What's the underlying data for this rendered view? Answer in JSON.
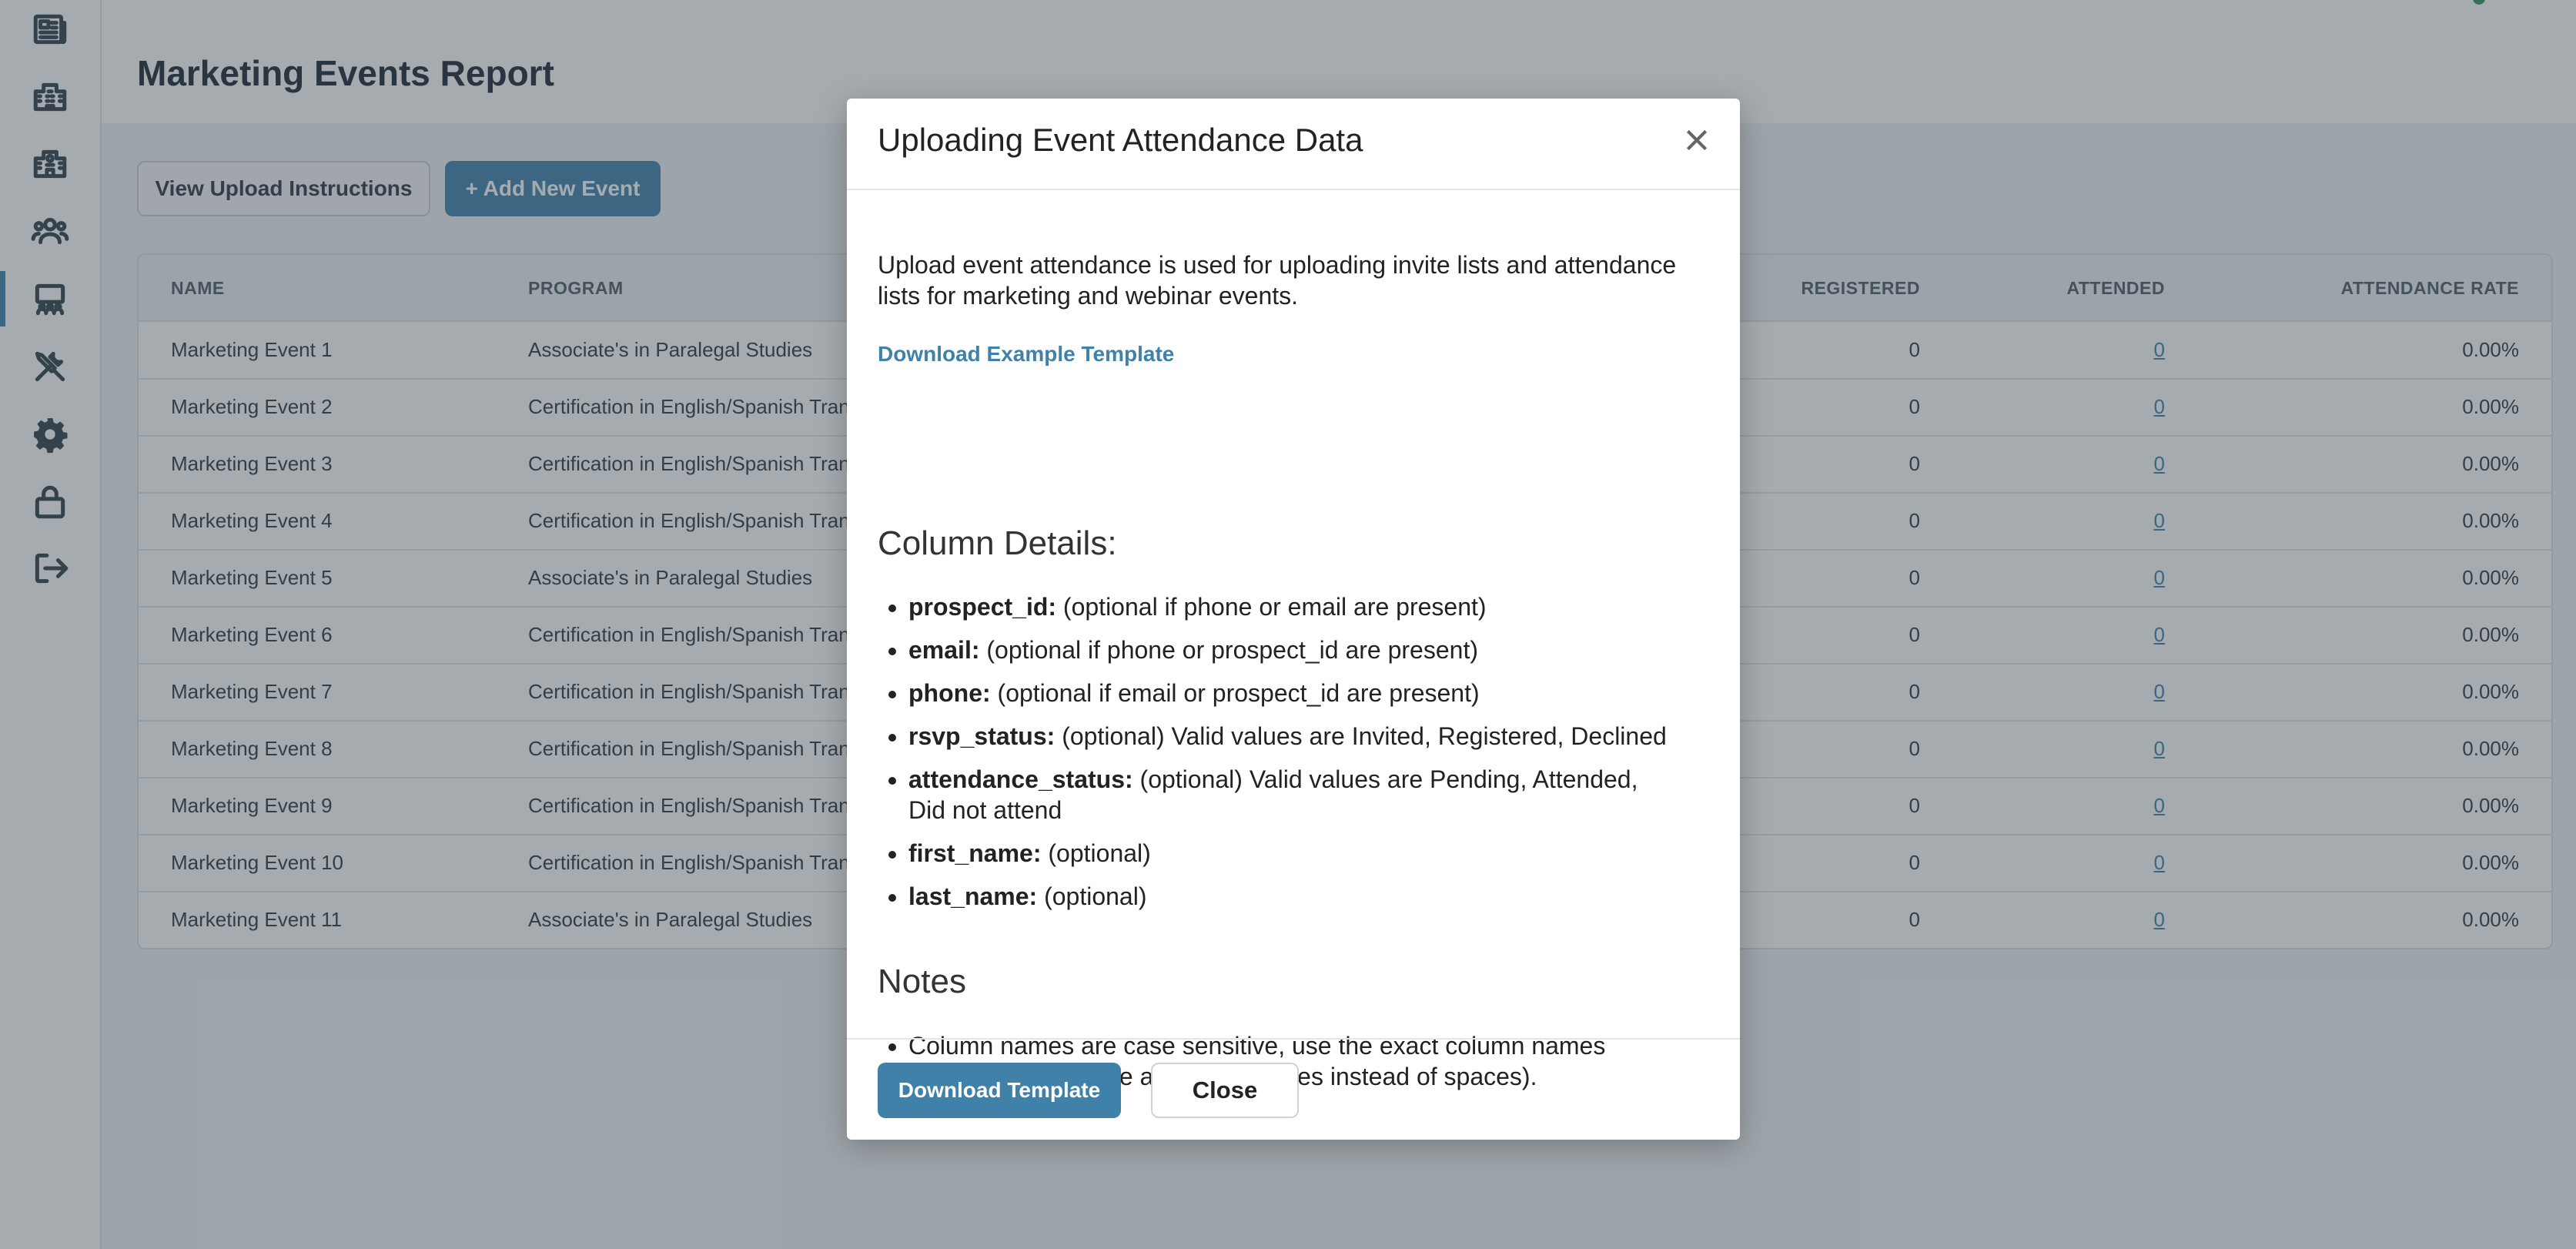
{
  "header": {
    "title": "Marketing Events Report"
  },
  "toolbar": {
    "instructions_label": "View Upload Instructions",
    "add_label": "+ Add New Event"
  },
  "sidebar": {
    "items": [
      {
        "icon": "newspaper-icon"
      },
      {
        "icon": "building-icon"
      },
      {
        "icon": "school-icon"
      },
      {
        "icon": "users-icon"
      },
      {
        "icon": "presentation-icon",
        "active": true
      },
      {
        "icon": "tools-icon"
      },
      {
        "icon": "gear-icon"
      },
      {
        "icon": "lock-icon"
      },
      {
        "icon": "logout-icon"
      }
    ]
  },
  "table": {
    "headers": {
      "name": "NAME",
      "program": "PROGRAM",
      "registered": "REGISTERED",
      "attended": "ATTENDED",
      "attendance_rate": "ATTENDANCE RATE"
    },
    "rows": [
      {
        "name": "Marketing Event 1",
        "program": "Associate's in Paralegal Studies",
        "registered": "0",
        "attended": "0",
        "rate": "0.00%"
      },
      {
        "name": "Marketing Event 2",
        "program": "Certification in English/Spanish Trans",
        "registered": "0",
        "attended": "0",
        "rate": "0.00%"
      },
      {
        "name": "Marketing Event 3",
        "program": "Certification in English/Spanish Trans",
        "registered": "0",
        "attended": "0",
        "rate": "0.00%"
      },
      {
        "name": "Marketing Event 4",
        "program": "Certification in English/Spanish Trans",
        "registered": "0",
        "attended": "0",
        "rate": "0.00%"
      },
      {
        "name": "Marketing Event 5",
        "program": "Associate's in Paralegal Studies",
        "registered": "0",
        "attended": "0",
        "rate": "0.00%"
      },
      {
        "name": "Marketing Event 6",
        "program": "Certification in English/Spanish Trans",
        "registered": "0",
        "attended": "0",
        "rate": "0.00%"
      },
      {
        "name": "Marketing Event 7",
        "program": "Certification in English/Spanish Trans",
        "registered": "0",
        "attended": "0",
        "rate": "0.00%"
      },
      {
        "name": "Marketing Event 8",
        "program": "Certification in English/Spanish Trans",
        "registered": "0",
        "attended": "0",
        "rate": "0.00%"
      },
      {
        "name": "Marketing Event 9",
        "program": "Certification in English/Spanish Trans",
        "registered": "0",
        "attended": "0",
        "rate": "0.00%"
      },
      {
        "name": "Marketing Event 10",
        "program": "Certification in English/Spanish Trans",
        "registered": "0",
        "attended": "0",
        "rate": "0.00%"
      },
      {
        "name": "Marketing Event 11",
        "program": "Associate's in Paralegal Studies",
        "registered": "0",
        "attended": "0",
        "rate": "0.00%"
      }
    ]
  },
  "modal": {
    "title": "Uploading Event Attendance Data",
    "intro": "Upload event attendance is used for uploading invite lists and attendance lists for marketing and webinar events.",
    "download_example_label": "Download Example Template",
    "column_details_heading": "Column Details:",
    "columns": [
      {
        "name": "prospect_id:",
        "desc": " (optional if phone or email are present)"
      },
      {
        "name": "email:",
        "desc": " (optional if phone or prospect_id are present)"
      },
      {
        "name": "phone:",
        "desc": " (optional if email or prospect_id are present)"
      },
      {
        "name": "rsvp_status:",
        "desc": " (optional) Valid values are Invited, Registered, Declined"
      },
      {
        "name": "attendance_status:",
        "desc": " (optional) Valid values are Pending, Attended, Did not attend"
      },
      {
        "name": "first_name:",
        "desc": " (optional)"
      },
      {
        "name": "last_name:",
        "desc": " (optional)"
      }
    ],
    "notes_heading": "Notes",
    "notes": [
      "Column names are case sensitive, use the exact column names above (all lowercase and underscores instead of spaces)."
    ],
    "download_template_label": "Download Template",
    "close_label": "Close"
  }
}
